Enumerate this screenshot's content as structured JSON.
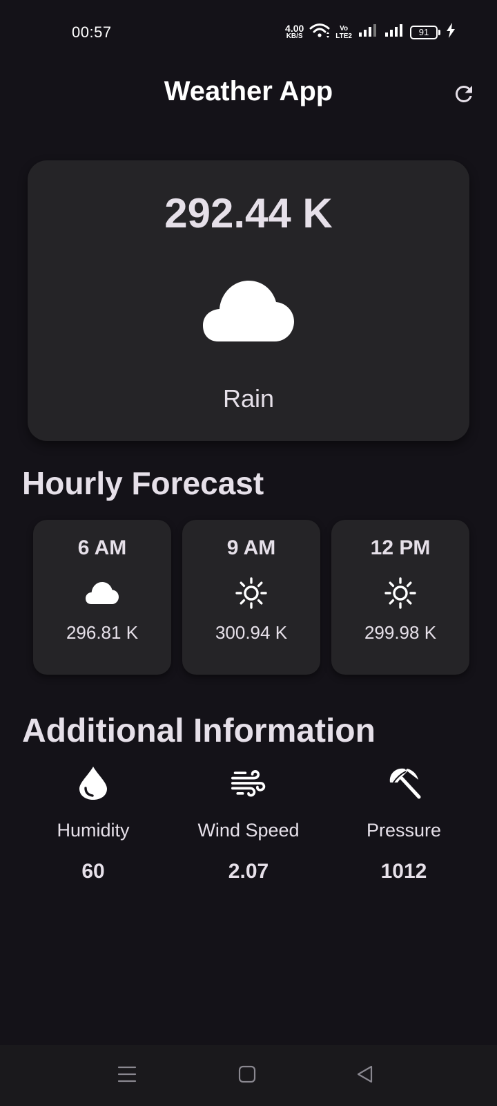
{
  "status_bar": {
    "time": "00:57",
    "net_speed_value": "4.00",
    "net_speed_unit": "KB/S",
    "volte_top": "Vo",
    "volte_bottom": "LTE2",
    "battery_level": "91"
  },
  "app_bar": {
    "title": "Weather App",
    "refresh_icon": "refresh-icon"
  },
  "current": {
    "temperature": "292.44 K",
    "icon": "cloud-icon",
    "condition": "Rain"
  },
  "hourly": {
    "title": "Hourly Forecast",
    "items": [
      {
        "time": "6 AM",
        "icon": "cloud-icon",
        "temperature": "296.81 K"
      },
      {
        "time": "9 AM",
        "icon": "sun-icon",
        "temperature": "300.94 K"
      },
      {
        "time": "12 PM",
        "icon": "sun-icon",
        "temperature": "299.98 K"
      }
    ]
  },
  "additional": {
    "title": "Additional Information",
    "items": [
      {
        "icon": "water-drop-icon",
        "label": "Humidity",
        "value": "60"
      },
      {
        "icon": "wind-icon",
        "label": "Wind Speed",
        "value": "2.07"
      },
      {
        "icon": "beach-umbrella-icon",
        "label": "Pressure",
        "value": "1012"
      }
    ]
  },
  "nav_bar": {
    "buttons": [
      "menu-icon",
      "home-square-icon",
      "back-triangle-icon"
    ]
  },
  "colors": {
    "background": "#141218",
    "card": "#252427",
    "text": "#e6e0e9",
    "nav_bar": "#1a191c"
  }
}
